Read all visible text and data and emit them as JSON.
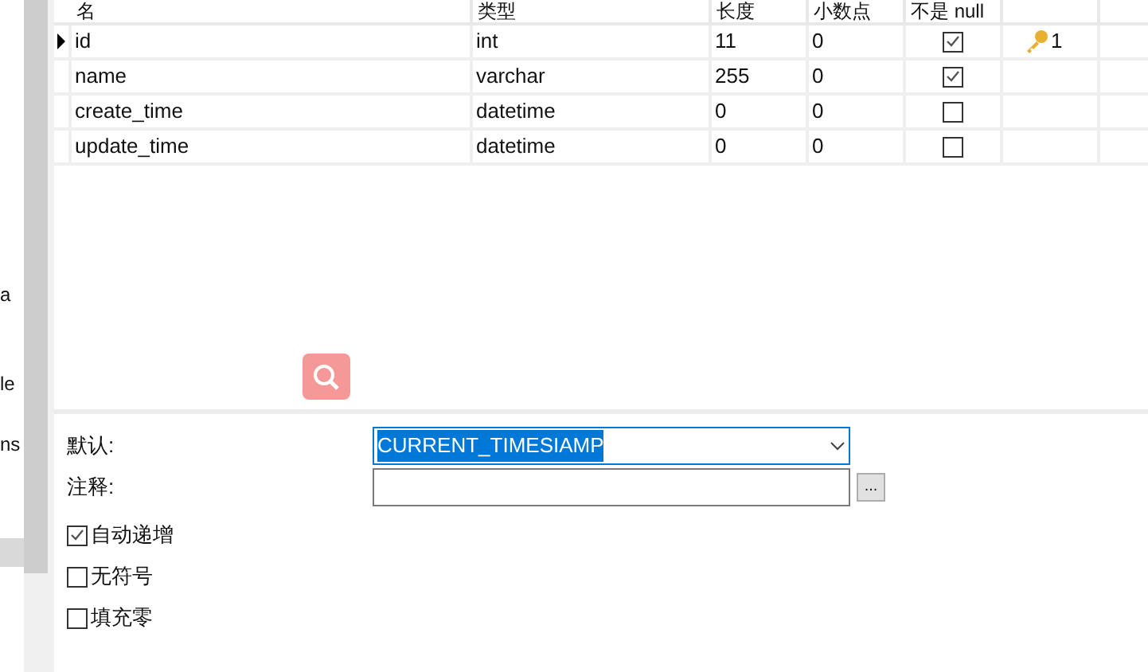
{
  "sidebar": {
    "items": [
      {
        "label": "a",
        "selected": false
      },
      {
        "label": "le",
        "selected": false
      },
      {
        "label": "ns",
        "selected": false
      },
      {
        "selected": true
      }
    ]
  },
  "table": {
    "columns": [
      "名",
      "类型",
      "长度",
      "小数点",
      "不是 null"
    ],
    "rows": [
      {
        "current": true,
        "name": "id",
        "type": "int",
        "length": "11",
        "decimals": "0",
        "not_null": true,
        "key": "1"
      },
      {
        "current": false,
        "name": "name",
        "type": "varchar",
        "length": "255",
        "decimals": "0",
        "not_null": true
      },
      {
        "current": false,
        "name": "create_time",
        "type": "datetime",
        "length": "0",
        "decimals": "0",
        "not_null": false
      },
      {
        "current": false,
        "name": "update_time",
        "type": "datetime",
        "length": "0",
        "decimals": "0",
        "not_null": false
      }
    ]
  },
  "properties": {
    "default": {
      "label": "默认:",
      "value": "CURRENT_TIMESIAMP",
      "selected": true
    },
    "comment": {
      "label": "注释:",
      "button": "..."
    },
    "options": [
      {
        "label": "自动递增",
        "checked": true
      },
      {
        "label": "无符号",
        "checked": false
      },
      {
        "label": "填充零",
        "checked": false
      }
    ]
  }
}
